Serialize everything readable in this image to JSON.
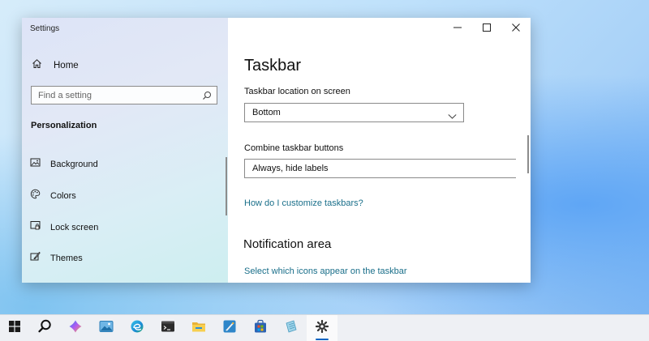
{
  "window": {
    "app_title": "Settings",
    "controls": {
      "minimize": "minimize",
      "maximize": "maximize",
      "close": "close"
    }
  },
  "sidebar": {
    "home_label": "Home",
    "search": {
      "placeholder": "Find a setting",
      "value": ""
    },
    "section_title": "Personalization",
    "items": [
      {
        "label": "Background",
        "icon": "picture-icon"
      },
      {
        "label": "Colors",
        "icon": "palette-icon"
      },
      {
        "label": "Lock screen",
        "icon": "lock-screen-icon"
      },
      {
        "label": "Themes",
        "icon": "brush-icon"
      }
    ]
  },
  "content": {
    "page_title": "Taskbar",
    "location": {
      "label": "Taskbar location on screen",
      "value": "Bottom"
    },
    "combine": {
      "label": "Combine taskbar buttons",
      "value": "Always, hide labels"
    },
    "help_link": "How do I customize taskbars?",
    "notification": {
      "heading": "Notification area",
      "link": "Select which icons appear on the taskbar"
    }
  },
  "taskbar": {
    "icons": [
      "start-icon",
      "search-icon",
      "copilot-icon",
      "photos-icon",
      "edge-icon",
      "terminal-icon",
      "file-explorer-icon",
      "paint-icon",
      "store-icon",
      "notepad-icon",
      "settings-icon"
    ],
    "accent": "#0a64c2"
  },
  "colors": {
    "link": "#1a6f8a",
    "accent": "#0a64c2"
  }
}
